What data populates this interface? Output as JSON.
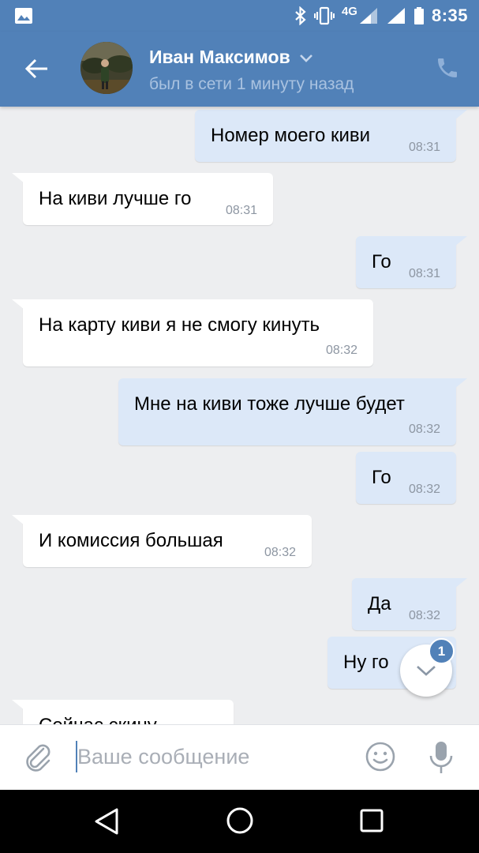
{
  "status_bar": {
    "time": "8:35",
    "network": "4G",
    "icons": [
      "gallery-icon",
      "bluetooth-icon",
      "vibrate-icon",
      "signal-icon",
      "signal-icon",
      "battery-icon"
    ]
  },
  "header": {
    "contact_name": "Иван Максимов",
    "last_seen": "был в сети 1 минуту назад",
    "icons": [
      "back-arrow-icon",
      "avatar",
      "chevron-down-icon",
      "phone-icon"
    ]
  },
  "messages": [
    {
      "dir": "out",
      "text": "Номер моего киви",
      "time": "08:31"
    },
    {
      "dir": "in",
      "text": "На киви лучше го",
      "time": "08:31"
    },
    {
      "dir": "out",
      "text": "Го",
      "time": "08:31"
    },
    {
      "dir": "in",
      "text": "На карту киви я не смогу кинуть",
      "time": "08:32"
    },
    {
      "dir": "out",
      "text": "Мне на киви тоже лучше будет",
      "time": "08:32"
    },
    {
      "dir": "out",
      "text": "Го",
      "time": "08:32"
    },
    {
      "dir": "in",
      "text": "И комиссия большая",
      "time": "08:32"
    },
    {
      "dir": "out",
      "text": "Да",
      "time": "08:32"
    },
    {
      "dir": "out",
      "text": "Ну го",
      "time": ""
    },
    {
      "dir": "in",
      "text": "Сейчас скину",
      "time": ""
    }
  ],
  "scroll_down": {
    "unread_count": "1"
  },
  "composer": {
    "placeholder": "Ваше сообщение",
    "value": "",
    "icons": [
      "paperclip-icon",
      "smile-icon",
      "microphone-icon"
    ]
  },
  "nav_bar": {
    "icons": [
      "nav-back-icon",
      "nav-home-icon",
      "nav-recents-icon"
    ]
  },
  "colors": {
    "accent": "#5181b8",
    "outgoing_bubble": "#dce8f8",
    "incoming_bubble": "#ffffff",
    "background": "#edeef0"
  }
}
